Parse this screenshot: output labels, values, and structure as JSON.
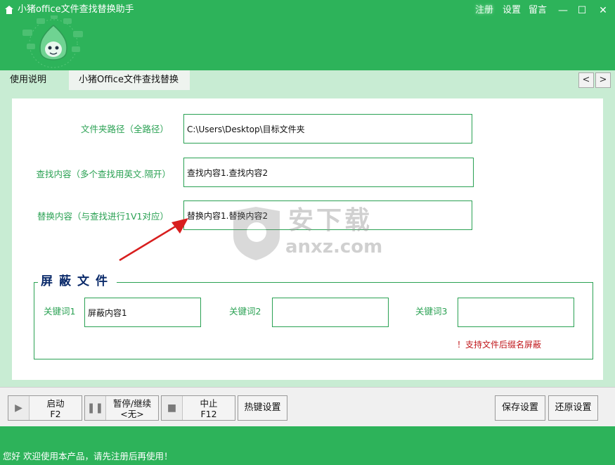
{
  "window": {
    "title": "小猪office文件查找替换助手",
    "links": [
      "注册",
      "设置",
      "留言"
    ],
    "controls": {
      "min": "—",
      "max": "☐",
      "close": "✕"
    }
  },
  "tabs": [
    {
      "label": "使用说明"
    },
    {
      "label": "小猪Office文件查找替换助手"
    }
  ],
  "tab_nav": {
    "prev": "<",
    "next": ">"
  },
  "form": {
    "folder_label": "文件夹路径（全路径）",
    "folder_value": "C:\\Users\\Desktop\\目标文件夹",
    "find_label": "查找内容（多个查找用英文.隔开）",
    "find_value": "查找内容1.查找内容2",
    "replace_label": "替换内容（与查找进行1V1对应）",
    "replace_value": "替换内容1.替换内容2"
  },
  "shield": {
    "title": "屏蔽文件",
    "keywords": [
      {
        "label": "关键词1",
        "value": "屏蔽内容1"
      },
      {
        "label": "关键词2",
        "value": ""
      },
      {
        "label": "关键词3",
        "value": ""
      }
    ],
    "note": "！支持文件后缀名屏蔽"
  },
  "toolbar": {
    "start": {
      "line1": "启动",
      "line2": "F2",
      "icon": "play-icon"
    },
    "pause": {
      "line1": "暂停/继续",
      "line2": "<无>",
      "icon": "pause-icon"
    },
    "stop": {
      "line1": "中止",
      "line2": "F12",
      "icon": "stop-icon"
    },
    "hotkey": "热键设置",
    "save": "保存设置",
    "restore": "还原设置"
  },
  "status": "您好 欢迎使用本产品，请先注册后再使用！",
  "watermark": {
    "text1": "安下载",
    "text2": "anxz.com"
  },
  "colors": {
    "brand_green": "#2db35a",
    "label_green": "#2aa153",
    "panel_mint": "#c8ecd3",
    "warning_red": "#c0171b",
    "title_navy": "#0a2a6a"
  }
}
